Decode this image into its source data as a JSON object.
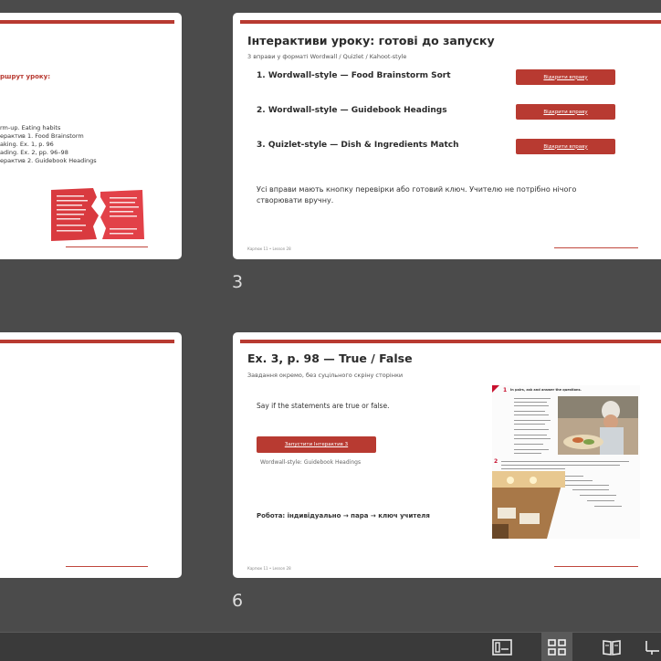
{
  "slide_left_top": {
    "heading": "ршрут уроку:",
    "list": [
      "rm-up. Eating habits",
      "ерактив 1. Food Brainstorm",
      "aking. Ex. 1, p. 96",
      "ading. Ex. 2, pp. 96–98",
      "ерактив 2. Guidebook Headings"
    ]
  },
  "slide3": {
    "number": "3",
    "title": "Інтерактиви уроку: готові до запуску",
    "subtitle": "3 вправи у форматі Wordwall / Quizlet / Kahoot-style",
    "items": [
      {
        "label": "1. Wordwall-style — Food Brainstorm Sort",
        "button": "Відкрити вправу"
      },
      {
        "label": "2. Wordwall-style — Guidebook Headings",
        "button": "Відкрити вправу"
      },
      {
        "label": "3. Quizlet-style — Dish & Ingredients Match",
        "button": "Відкрити вправу"
      }
    ],
    "note": "Усі вправи мають кнопку перевірки або готовий ключ. Учителю не потрібно нічого створювати вручну.",
    "footer": "Карпюк 11 • Lesson 28"
  },
  "slide6": {
    "number": "6",
    "title": "Ex. 3, p. 98 — True / False",
    "subtitle": "Завдання окремо, без суцільного скріну сторінки",
    "instruction": "Say if the statements are true or false.",
    "button": "Запустити Інтерактив 3",
    "caption": "Wordwall-style: Guidebook Headings",
    "work": "Робота: індивідуально → пара → ключ учителя",
    "footer": "Карпюк 11 • Lesson 28",
    "book_heading": "In pairs, ask and answer the questions."
  },
  "taskbar": {
    "buttons": [
      "normal-view",
      "slide-sorter",
      "reading-view",
      "more"
    ]
  },
  "colors": {
    "accent": "#b83a31",
    "background": "#4b4b4b"
  }
}
